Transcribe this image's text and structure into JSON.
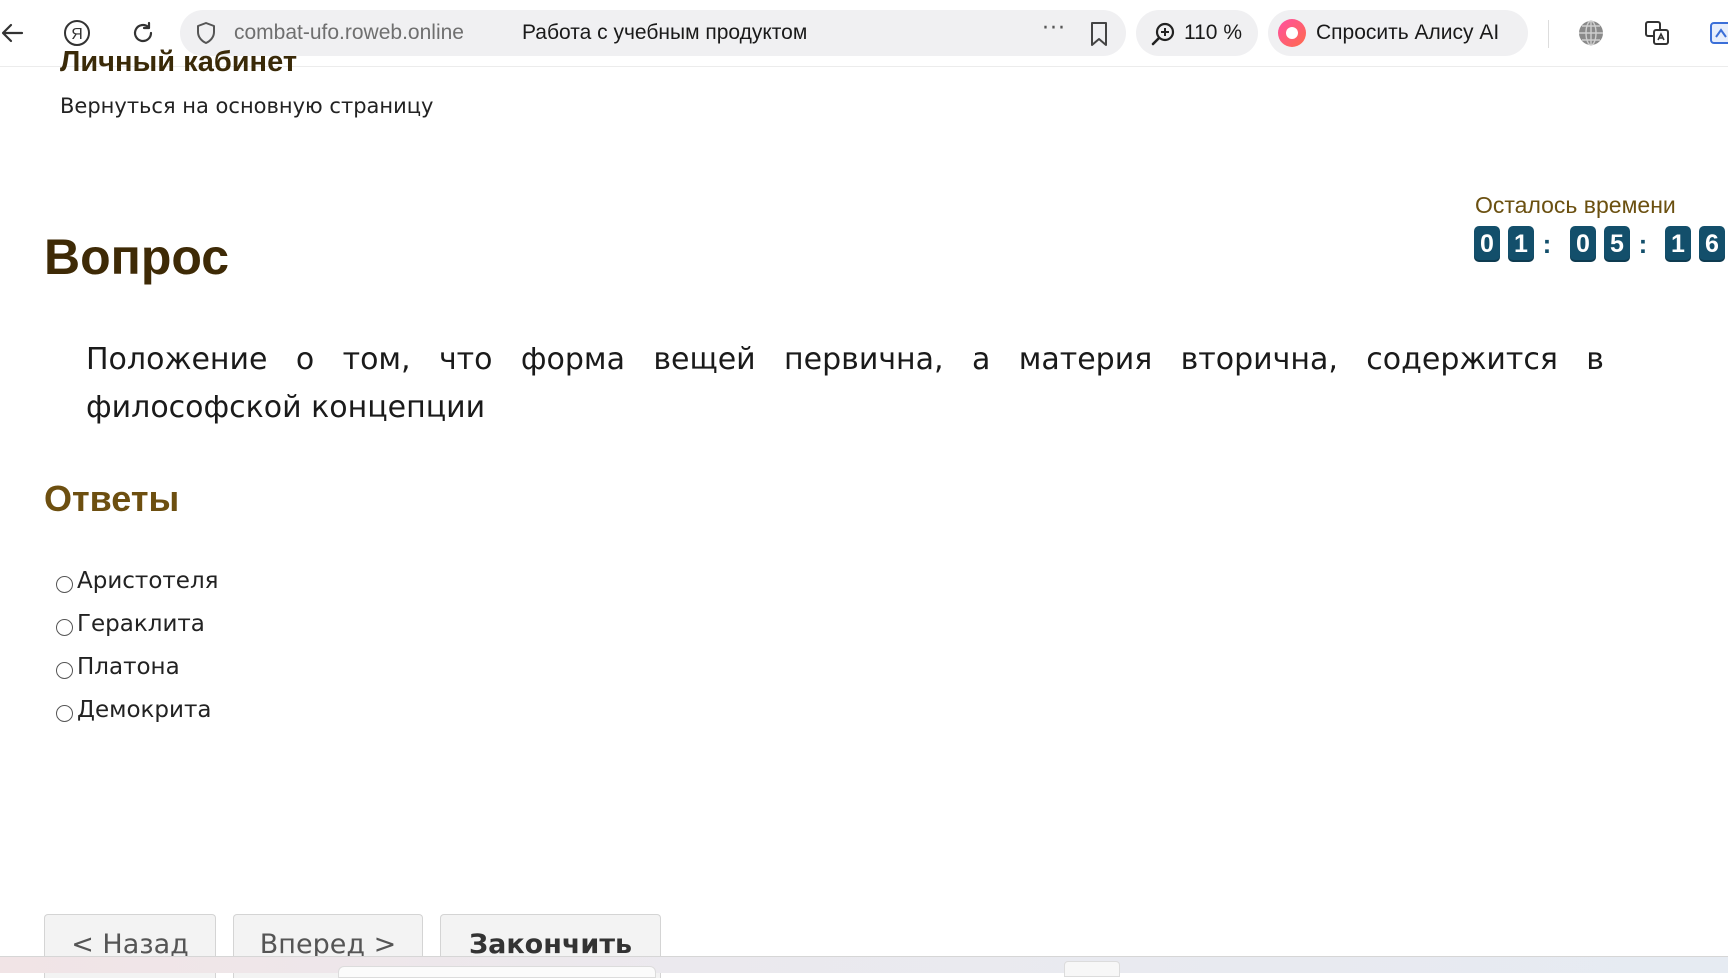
{
  "browser": {
    "domain": "combat-ufo.roweb.online",
    "page_title": "Работа с учебным продуктом",
    "more_glyph": "···",
    "zoom": "110 %",
    "alice_label": "Спросить Алису AI",
    "icons": [
      "back-arrow-icon",
      "yandex-icon",
      "reload-icon",
      "shield-icon",
      "more-icon",
      "bookmark-icon",
      "zoom-icon",
      "alice-icon",
      "globe-icon",
      "translate-icon",
      "extension-icon"
    ]
  },
  "header": {
    "cabinet_title": "Личный кабинет",
    "back_link": "Вернуться на основную страницу"
  },
  "timer": {
    "label": "Осталось времени",
    "digits": [
      "0",
      "1",
      "0",
      "5",
      "1",
      "6"
    ],
    "separator": ":",
    "digit_color": "#134f6b"
  },
  "question": {
    "heading": "Вопрос",
    "text": "Положение о том, что форма вещей первична, а материя вторична, содержится в философской концепции"
  },
  "answers": {
    "heading": "Ответы",
    "options": [
      {
        "label": "Аристотеля",
        "selected": false
      },
      {
        "label": "Гераклита",
        "selected": false
      },
      {
        "label": "Платона",
        "selected": false
      },
      {
        "label": "Демокрита",
        "selected": false
      }
    ]
  },
  "nav": {
    "back": "< Назад",
    "next": "Вперед >",
    "finish": "Закончить"
  },
  "colors": {
    "heading_brown": "#3e2a06",
    "answers_heading": "#6d4f10",
    "timer_label": "#6b5010"
  }
}
